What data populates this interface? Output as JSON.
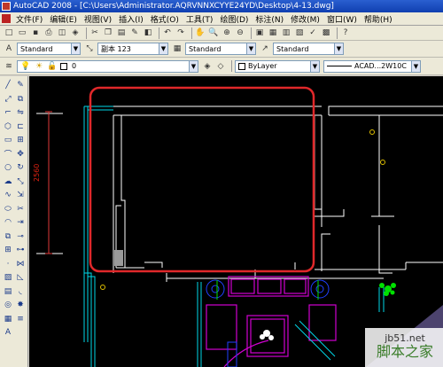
{
  "window": {
    "title": "AutoCAD 2008 - [C:\\Users\\Administrator.AQRVNNXCYYE24YD\\Desktop\\4-13.dwg]"
  },
  "menu": [
    "文件(F)",
    "编辑(E)",
    "视图(V)",
    "插入(I)",
    "格式(O)",
    "工具(T)",
    "绘图(D)",
    "标注(N)",
    "修改(M)",
    "窗口(W)",
    "帮助(H)"
  ],
  "toolbar": {
    "text_style": "Standard",
    "dim_style": "副本 123",
    "table_style": "Standard",
    "multileader_style": "Standard",
    "layer_value": "0",
    "color_value": "ByLayer",
    "linetype_value": "ACAD...2W10C"
  },
  "drawing": {
    "dimension_label": "2560"
  },
  "watermark": {
    "line1": "jb51.net",
    "line2": "脚本之家"
  },
  "colors": {
    "accent": "#0f3fb0",
    "highlight": "#e0282a",
    "canvas": "#000000"
  }
}
